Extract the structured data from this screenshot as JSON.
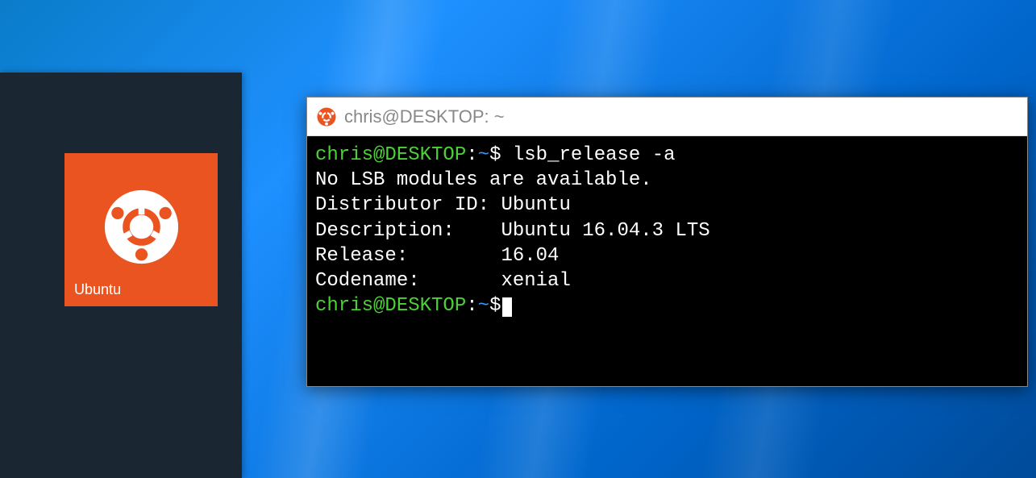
{
  "start_panel": {
    "tile": {
      "label": "Ubuntu",
      "icon": "ubuntu-logo"
    }
  },
  "terminal": {
    "title": "chris@DESKTOP: ~",
    "icon": "ubuntu-logo",
    "prompt": {
      "user": "chris",
      "host": "DESKTOP",
      "path": "~",
      "symbol": "$"
    },
    "command": "lsb_release -a",
    "output": {
      "line1": "No LSB modules are available.",
      "line2": "Distributor ID: Ubuntu",
      "line3": "Description:    Ubuntu 16.04.3 LTS",
      "line4": "Release:        16.04",
      "line5": "Codename:       xenial"
    }
  }
}
